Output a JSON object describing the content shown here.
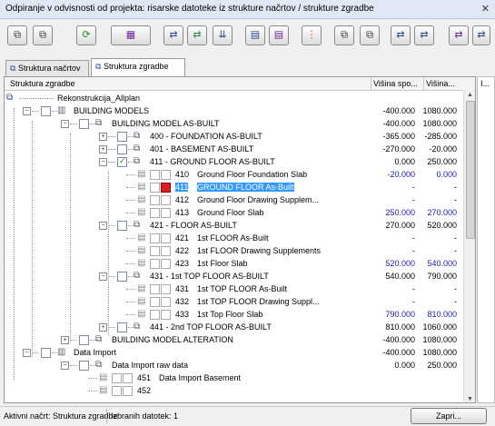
{
  "window": {
    "title": "Odpiranje v odvisnosti od projekta: risarske datoteke iz strukture načrtov / strukture zgradbe",
    "close": "✕"
  },
  "toolbar": [
    {
      "name": "toolbar-btn-1-icon",
      "glyph": "⧉",
      "color": "#333"
    },
    {
      "name": "toolbar-btn-2-icon",
      "glyph": "⧉",
      "color": "#333"
    },
    {
      "name": "refresh-icon",
      "glyph": "⟳",
      "color": "#1a8a1a"
    },
    {
      "name": "toolbar-btn-4-icon",
      "glyph": "▦",
      "color": "#6a2a9a"
    },
    {
      "name": "toolbar-btn-5-icon",
      "glyph": "⇄",
      "color": "#2a4a9a"
    },
    {
      "name": "toolbar-btn-6-icon",
      "glyph": "⇄",
      "color": "#2a8a4a"
    },
    {
      "name": "toolbar-btn-7-icon",
      "glyph": "⇊",
      "color": "#2a4a9a"
    },
    {
      "name": "toolbar-btn-8-icon",
      "glyph": "▤",
      "color": "#2a4a9a"
    },
    {
      "name": "toolbar-btn-9-icon",
      "glyph": "▤",
      "color": "#6a2a9a"
    },
    {
      "name": "info-icon",
      "glyph": "⋮",
      "color": "#c07000"
    },
    {
      "name": "toolbar-btn-11-icon",
      "glyph": "⧉",
      "color": "#333"
    },
    {
      "name": "toolbar-btn-12-icon",
      "glyph": "⧉",
      "color": "#333"
    },
    {
      "name": "toolbar-btn-13-icon",
      "glyph": "⇄",
      "color": "#2a4a9a"
    },
    {
      "name": "toolbar-btn-14-icon",
      "glyph": "⇄",
      "color": "#2a4a9a"
    },
    {
      "name": "toolbar-btn-15-icon",
      "glyph": "⇄",
      "color": "#6a2a9a"
    },
    {
      "name": "toolbar-btn-16-icon",
      "glyph": "⇄",
      "color": "#2a4a9a"
    }
  ],
  "tabs": [
    {
      "label": "Struktura načrtov",
      "active": false
    },
    {
      "label": "Struktura zgradbe",
      "active": true
    }
  ],
  "columns": {
    "name": "Struktura zgradbe",
    "height1": "Višina spo...",
    "height2": "Višina...",
    "extra": "I..."
  },
  "rows": [
    {
      "level": 0,
      "exp": "",
      "cb": null,
      "icon": "root-icon",
      "name": "Rekonstrukcija_Allplan",
      "v1": "",
      "v2": "",
      "bold": false,
      "type": "root"
    },
    {
      "level": 1,
      "exp": "−",
      "cb": "off",
      "icon": "structure-icon",
      "name": "BUILDING MODELS",
      "v1": "-400.000",
      "v2": "1080.000",
      "bold": false,
      "type": "node"
    },
    {
      "level": 2,
      "exp": "−",
      "cb": "off",
      "icon": "stack-icon",
      "name": "BUILDING MODEL AS-BUILT",
      "v1": "-400.000",
      "v2": "1080.000",
      "bold": false,
      "type": "node"
    },
    {
      "level": 3,
      "exp": "+",
      "cb": "off",
      "icon": "stack-icon",
      "name": "400 - FOUNDATION AS-BUILT",
      "v1": "-365.000",
      "v2": "-285.000",
      "bold": false,
      "type": "node"
    },
    {
      "level": 3,
      "exp": "+",
      "cb": "off",
      "icon": "stack-icon",
      "name": "401 - BASEMENT AS-BUILT",
      "v1": "-270.000",
      "v2": "-20.000",
      "bold": false,
      "type": "node"
    },
    {
      "level": 3,
      "exp": "−",
      "cb": "on",
      "icon": "stack-icon",
      "name": "411 - GROUND FLOOR AS-BUILT",
      "v1": "0.000",
      "v2": "250.000",
      "bold": false,
      "type": "node"
    },
    {
      "level": 4,
      "num": "410",
      "name": "Ground Floor Foundation Slab",
      "v1": "-20.000",
      "v2": "0.000",
      "blue": true,
      "type": "file"
    },
    {
      "level": 4,
      "num": "411",
      "name": "GROUND FLOOR As-Built",
      "v1": "-",
      "v2": "-",
      "blue": false,
      "type": "file",
      "selected": true,
      "red": true
    },
    {
      "level": 4,
      "num": "412",
      "name": "Ground Floor Drawing Supplem...",
      "v1": "-",
      "v2": "-",
      "blue": false,
      "type": "file"
    },
    {
      "level": 4,
      "num": "413",
      "name": "Ground Floor Slab",
      "v1": "250.000",
      "v2": "270.000",
      "blue": true,
      "type": "file"
    },
    {
      "level": 3,
      "exp": "−",
      "cb": "off",
      "icon": "stack-icon",
      "name": "421 - FLOOR AS-BUILT",
      "v1": "270.000",
      "v2": "520.000",
      "bold": false,
      "type": "node"
    },
    {
      "level": 4,
      "num": "421",
      "name": "1st FLOOR As-Built",
      "v1": "-",
      "v2": "-",
      "blue": false,
      "type": "file"
    },
    {
      "level": 4,
      "num": "422",
      "name": "1st FLOOR Drawing Supplements",
      "v1": "-",
      "v2": "-",
      "blue": false,
      "type": "file"
    },
    {
      "level": 4,
      "num": "423",
      "name": "1st Floor Slab",
      "v1": "520.000",
      "v2": "540.000",
      "blue": true,
      "type": "file"
    },
    {
      "level": 3,
      "exp": "−",
      "cb": "off",
      "icon": "stack-icon",
      "name": "431 - 1st TOP FLOOR AS-BUILT",
      "v1": "540.000",
      "v2": "790.000",
      "bold": false,
      "type": "node"
    },
    {
      "level": 4,
      "num": "431",
      "name": "1st TOP FLOOR As-Built",
      "v1": "-",
      "v2": "-",
      "blue": false,
      "type": "file"
    },
    {
      "level": 4,
      "num": "432",
      "name": "1st TOP FLOOR Drawing Suppl...",
      "v1": "-",
      "v2": "-",
      "blue": false,
      "type": "file"
    },
    {
      "level": 4,
      "num": "433",
      "name": "1st Top Floor Slab",
      "v1": "790.000",
      "v2": "810.000",
      "blue": true,
      "type": "file"
    },
    {
      "level": 3,
      "exp": "+",
      "cb": "off",
      "icon": "stack-icon",
      "name": "441 - 2nd TOP FLOOR AS-BUILT",
      "v1": "810.000",
      "v2": "1060.000",
      "bold": false,
      "type": "node"
    },
    {
      "level": 2,
      "exp": "+",
      "cb": "off",
      "icon": "stack-icon",
      "name": "BUILDING MODEL ALTERATION",
      "v1": "-400.000",
      "v2": "1080.000",
      "bold": false,
      "type": "node"
    },
    {
      "level": 1,
      "exp": "−",
      "cb": "off",
      "icon": "structure-icon",
      "name": "Data Import",
      "v1": "-400.000",
      "v2": "1080.000",
      "bold": false,
      "type": "node"
    },
    {
      "level": 2,
      "exp": "−",
      "cb": "off",
      "icon": "stack-icon",
      "name": "Data Import raw data",
      "v1": "0.000",
      "v2": "250.000",
      "bold": false,
      "type": "node"
    },
    {
      "level": 3,
      "num": "451",
      "name": "Data Import Basement",
      "v1": "",
      "v2": "",
      "blue": false,
      "type": "file"
    },
    {
      "level": 3,
      "num": "452",
      "name": "",
      "v1": "",
      "v2": "",
      "blue": false,
      "type": "file"
    }
  ],
  "status": {
    "active_drawing": "Aktivni načrt: Struktura zgradbe",
    "selected_files": "Izbranih datotek: 1",
    "close_button": "Zapri..."
  }
}
